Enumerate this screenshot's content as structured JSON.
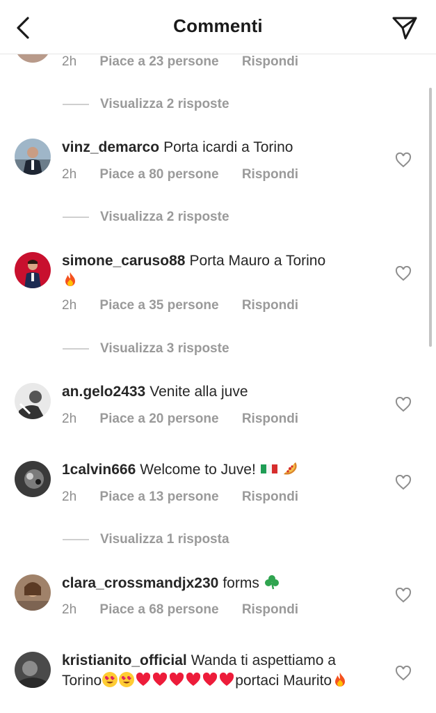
{
  "header": {
    "title": "Commenti"
  },
  "top_partial": {
    "time": "2h",
    "likes": "Piace a 23 persone",
    "reply": "Rispondi",
    "view_replies": "Visualizza 2 risposte"
  },
  "comments": [
    {
      "username": "vinz_demarco",
      "text": "Porta icardi a Torino",
      "time": "2h",
      "likes": "Piace a 80 persone",
      "reply": "Rispondi",
      "view_replies": "Visualizza 2 risposte"
    },
    {
      "username": "simone_caruso88",
      "text": "Porta Mauro a Torino",
      "time": "2h",
      "likes": "Piace a 35 persone",
      "reply": "Rispondi",
      "view_replies": "Visualizza 3 risposte"
    },
    {
      "username": "an.gelo2433",
      "text": "Venite alla juve",
      "time": "2h",
      "likes": "Piace a 20 persone",
      "reply": "Rispondi"
    },
    {
      "username": "1calvin666",
      "text": "Welcome to Juve!",
      "time": "2h",
      "likes": "Piace a 13 persone",
      "reply": "Rispondi",
      "view_replies": "Visualizza 1 risposta"
    },
    {
      "username": "clara_crossmandjx230",
      "text": "forms",
      "time": "2h",
      "likes": "Piace a 68 persone",
      "reply": "Rispondi"
    },
    {
      "username": "kristianito_official",
      "text_a": "Wanda ti aspettiamo a Torino",
      "text_b": "portaci Maurito"
    }
  ],
  "colors": {
    "text": "#262626",
    "muted": "#8e8e8e",
    "heart_red": "#ed1c3a"
  },
  "icons": [
    "back-arrow-icon",
    "send-icon",
    "heart-outline-icon",
    "fire-emoji",
    "italy-flag-emoji",
    "pizza-emoji",
    "shamrock-emoji",
    "heart-eyes-emoji",
    "red-heart-emoji"
  ]
}
